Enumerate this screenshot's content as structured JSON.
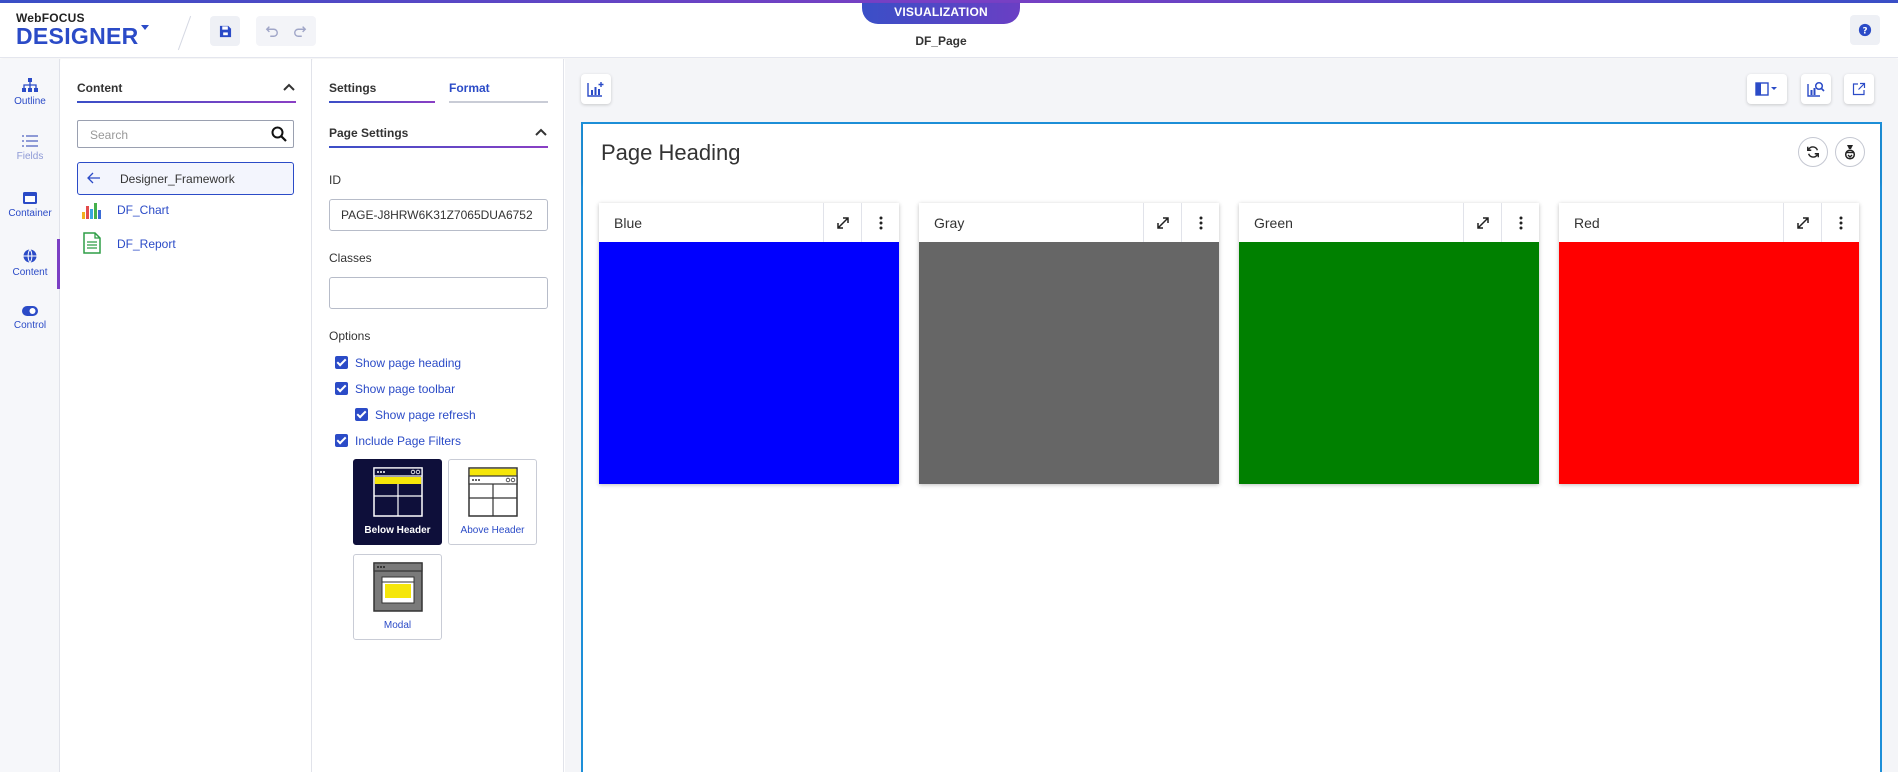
{
  "app": {
    "brand_small": "WebFOCUS",
    "brand_big": "DESIGNER",
    "mode_tab": "VISUALIZATION",
    "page_name": "DF_Page"
  },
  "colors": {
    "accent": "#2b4bc7",
    "accent_purple": "#7b3fc4",
    "frame_border": "#1d8fd8"
  },
  "rail": {
    "items": [
      {
        "label": "Outline",
        "icon": "sitemap-icon"
      },
      {
        "label": "Fields",
        "icon": "list-icon"
      },
      {
        "label": "Container",
        "icon": "container-icon"
      },
      {
        "label": "Content",
        "icon": "globe-icon"
      },
      {
        "label": "Control",
        "icon": "toggle-icon"
      }
    ]
  },
  "content_panel": {
    "title": "Content",
    "search_placeholder": "Search",
    "selected_folder": "Designer_Framework",
    "items": [
      {
        "label": "DF_Chart",
        "icon": "chart-icon"
      },
      {
        "label": "DF_Report",
        "icon": "report-icon"
      }
    ]
  },
  "settings_panel": {
    "tabs": [
      {
        "label": "Settings",
        "active": true
      },
      {
        "label": "Format",
        "active": false
      }
    ],
    "section_title": "Page Settings",
    "id_label": "ID",
    "id_value": "PAGE-J8HRW6K31Z7065DUA6752",
    "classes_label": "Classes",
    "classes_value": "",
    "options_label": "Options",
    "options": [
      {
        "label": "Show page heading",
        "checked": true
      },
      {
        "label": "Show page toolbar",
        "checked": true
      },
      {
        "label": "Show page refresh",
        "checked": true
      },
      {
        "label": "Include Page Filters",
        "checked": true
      }
    ],
    "filter_layouts": [
      {
        "label": "Below Header",
        "selected": true
      },
      {
        "label": "Above Header",
        "selected": false
      },
      {
        "label": "Modal",
        "selected": false
      }
    ]
  },
  "page": {
    "heading": "Page Heading",
    "cards": [
      {
        "title": "Blue",
        "color": "#0000ff"
      },
      {
        "title": "Gray",
        "color": "#666666"
      },
      {
        "title": "Green",
        "color": "#008000"
      },
      {
        "title": "Red",
        "color": "#ff0000"
      }
    ]
  }
}
